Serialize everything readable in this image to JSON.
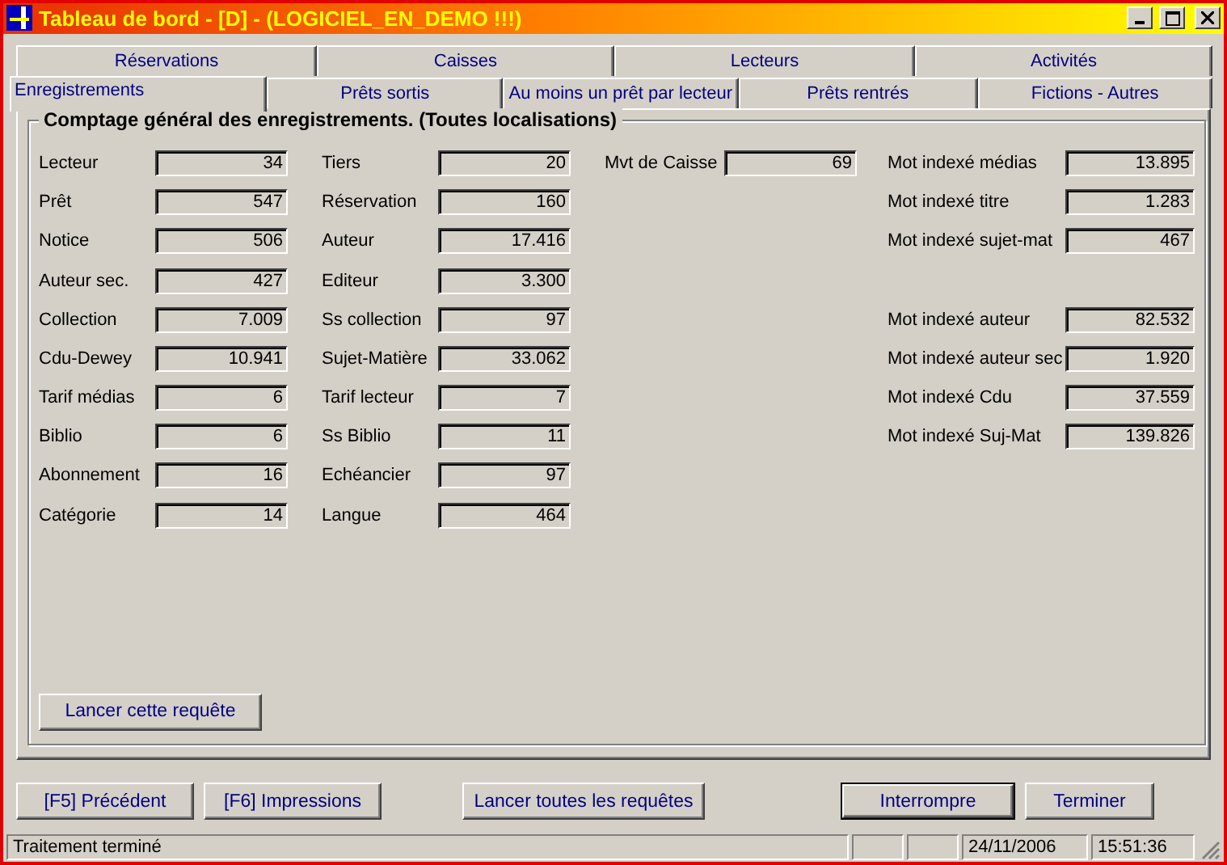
{
  "window": {
    "title": "Tableau de bord  - [D] - (LOGICIEL_EN_DEMO !!!)"
  },
  "tab_rows": [
    [
      {
        "label": "Réservations",
        "selected": false
      },
      {
        "label": "Caisses",
        "selected": false
      },
      {
        "label": "Lecteurs",
        "selected": false
      },
      {
        "label": "Activités",
        "selected": false
      }
    ],
    [
      {
        "label": "Enregistrements",
        "selected": true
      },
      {
        "label": "Prêts sortis",
        "selected": false
      },
      {
        "label": "Au moins un prêt par lecteur",
        "selected": false
      },
      {
        "label": "Prêts rentrés",
        "selected": false
      },
      {
        "label": "Fictions - Autres",
        "selected": false
      }
    ]
  ],
  "group": {
    "title": "Comptage général des enregistrements. (Toutes localisations)",
    "columns": [
      [
        {
          "kind": "field",
          "label": "Lecteur",
          "value": "34"
        },
        {
          "kind": "field",
          "label": "Prêt",
          "value": "547"
        },
        {
          "kind": "field",
          "label": "Notice",
          "value": "506"
        },
        {
          "kind": "field",
          "label": "Auteur sec.",
          "value": "427"
        },
        {
          "kind": "field",
          "label": "Collection",
          "value": "7.009"
        },
        {
          "kind": "field",
          "label": "Cdu-Dewey",
          "value": "10.941"
        },
        {
          "kind": "field",
          "label": "Tarif médias",
          "value": "6"
        },
        {
          "kind": "field",
          "label": "Biblio",
          "value": "6"
        },
        {
          "kind": "field",
          "label": "Abonnement",
          "value": "16"
        },
        {
          "kind": "field",
          "label": "Catégorie",
          "value": "14"
        }
      ],
      [
        {
          "kind": "field",
          "label": "Tiers",
          "value": "20"
        },
        {
          "kind": "field",
          "label": "Réservation",
          "value": "160"
        },
        {
          "kind": "field",
          "label": "Auteur",
          "value": "17.416"
        },
        {
          "kind": "field",
          "label": "Editeur",
          "value": "3.300"
        },
        {
          "kind": "field",
          "label": "Ss collection",
          "value": "97"
        },
        {
          "kind": "field",
          "label": "Sujet-Matière",
          "value": "33.062"
        },
        {
          "kind": "field",
          "label": "Tarif lecteur",
          "value": "7"
        },
        {
          "kind": "field",
          "label": "Ss Biblio",
          "value": "11"
        },
        {
          "kind": "field",
          "label": "Echéancier",
          "value": "97"
        },
        {
          "kind": "field",
          "label": "Langue",
          "value": "464"
        }
      ],
      [
        {
          "kind": "field",
          "label": "Mvt de Caisse",
          "value": "69"
        }
      ],
      [
        {
          "kind": "field",
          "label": "Mot indexé médias",
          "value": "13.895"
        },
        {
          "kind": "field",
          "label": "Mot indexé titre",
          "value": "1.283"
        },
        {
          "kind": "field",
          "label": "Mot indexé sujet-mat",
          "value": "467"
        },
        {
          "kind": "spacer"
        },
        {
          "kind": "field",
          "label": "Mot indexé auteur",
          "value": "82.532"
        },
        {
          "kind": "field",
          "label": "Mot indexé auteur sec",
          "value": "1.920"
        },
        {
          "kind": "field",
          "label": "Mot indexé Cdu",
          "value": "37.559"
        },
        {
          "kind": "field",
          "label": "Mot indexé Suj-Mat",
          "value": "139.826"
        }
      ]
    ],
    "run_button": "Lancer cette requête"
  },
  "buttons": [
    {
      "label": "[F5] Précédent",
      "default": false
    },
    {
      "label": "[F6] Impressions",
      "default": false
    },
    {
      "label": "Lancer toutes les requêtes",
      "default": false
    },
    {
      "label": "Interrompre",
      "default": true
    },
    {
      "label": "Terminer",
      "default": false
    }
  ],
  "status_bar": {
    "message": "Traitement terminé",
    "date": "24/11/2006",
    "time": "15:51:36"
  }
}
